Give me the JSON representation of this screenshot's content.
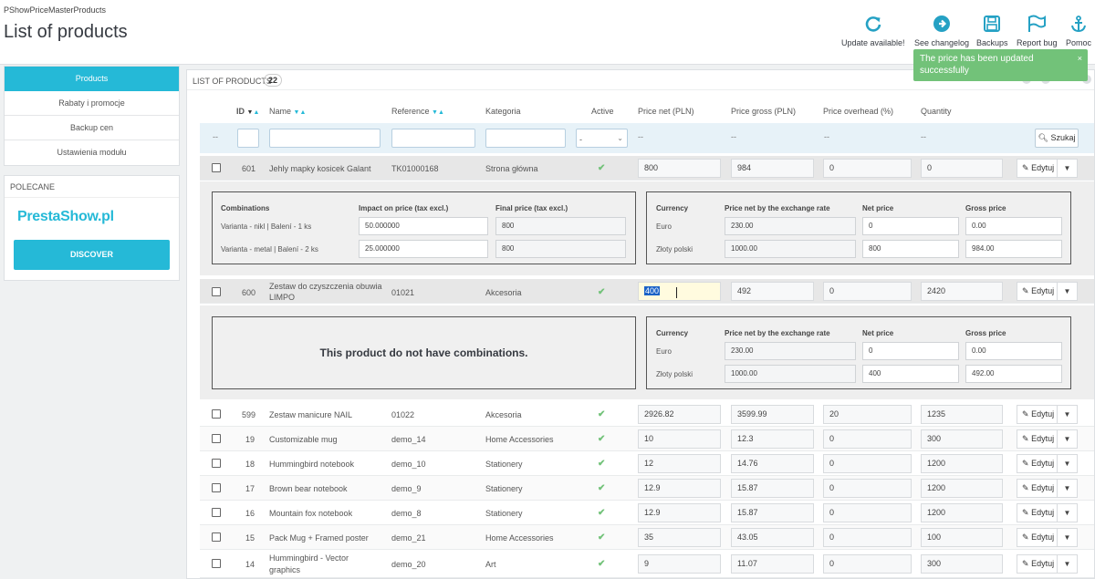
{
  "header": {
    "module_name": "PShowPriceMasterProducts",
    "page_title": "List of products",
    "toolbar": {
      "update": "Update available!",
      "changelog": "See changelog",
      "backups": "Backups",
      "report": "Report bug",
      "help": "Pomoc"
    }
  },
  "sidebar": {
    "items": [
      "Products",
      "Rabaty i promocje",
      "Backup cen",
      "Ustawienia modułu"
    ],
    "polecane": "POLECANE",
    "logo": "PrestaShow.pl",
    "discover": "DISCOVER"
  },
  "toast": {
    "message": "The price has been updated successfully",
    "close": "×"
  },
  "list": {
    "title": "LIST OF PRODUCTS",
    "count": "22",
    "headers": {
      "id": "ID",
      "name": "Name",
      "reference": "Reference",
      "category": "Kategoria",
      "active": "Active",
      "price_net": "Price net (PLN)",
      "price_gross": "Price gross (PLN)",
      "overhead": "Price overhead (%)",
      "quantity": "Quantity"
    },
    "filter": {
      "dash": "--",
      "select": "-",
      "search": "Szukaj"
    },
    "edit_label": "Edytuj",
    "products": [
      {
        "id": "601",
        "name": "Jehly mapky kosicek Galant",
        "ref": "TK01000168",
        "cat": "Strona główna",
        "net": "800",
        "gross": "984",
        "over": "0",
        "qty": "0"
      },
      {
        "id": "600",
        "name": "Zestaw do czyszczenia obuwia",
        "name2": "LIMPO",
        "ref": "01021",
        "cat": "Akcesoria",
        "net": "400",
        "gross": "492",
        "over": "0",
        "qty": "2420"
      },
      {
        "id": "599",
        "name": "Zestaw manicure NAIL",
        "ref": "01022",
        "cat": "Akcesoria",
        "net": "2926.82",
        "gross": "3599.99",
        "over": "20",
        "qty": "1235"
      },
      {
        "id": "19",
        "name": "Customizable mug",
        "ref": "demo_14",
        "cat": "Home Accessories",
        "net": "10",
        "gross": "12.3",
        "over": "0",
        "qty": "300"
      },
      {
        "id": "18",
        "name": "Hummingbird notebook",
        "ref": "demo_10",
        "cat": "Stationery",
        "net": "12",
        "gross": "14.76",
        "over": "0",
        "qty": "1200"
      },
      {
        "id": "17",
        "name": "Brown bear notebook",
        "ref": "demo_9",
        "cat": "Stationery",
        "net": "12.9",
        "gross": "15.87",
        "over": "0",
        "qty": "1200"
      },
      {
        "id": "16",
        "name": "Mountain fox notebook",
        "ref": "demo_8",
        "cat": "Stationery",
        "net": "12.9",
        "gross": "15.87",
        "over": "0",
        "qty": "1200"
      },
      {
        "id": "15",
        "name": "Pack Mug + Framed poster",
        "ref": "demo_21",
        "cat": "Home Accessories",
        "net": "35",
        "gross": "43.05",
        "over": "0",
        "qty": "100"
      },
      {
        "id": "14",
        "name": "Hummingbird - Vector",
        "name2": "graphics",
        "ref": "demo_20",
        "cat": "Art",
        "net": "9",
        "gross": "11.07",
        "over": "0",
        "qty": "300"
      }
    ],
    "combinations": {
      "headers": [
        "Combinations",
        "Impact on price (tax excl.)",
        "Final price (tax excl.)"
      ],
      "rows": [
        {
          "name": "Varianta - nikl | Balení - 1 ks",
          "impact": "50.000000",
          "final": "800"
        },
        {
          "name": "Varianta - metal | Balení - 2 ks",
          "impact": "25.000000",
          "final": "800"
        }
      ],
      "empty": "This product do not have combinations."
    },
    "currency": {
      "headers": [
        "Currency",
        "Price net by the exchange rate",
        "Net price",
        "Gross price"
      ],
      "p601": [
        {
          "cur": "Euro",
          "rate": "230.00",
          "net": "0",
          "gross": "0.00"
        },
        {
          "cur": "Złoty polski",
          "rate": "1000.00",
          "net": "800",
          "gross": "984.00"
        }
      ],
      "p600": [
        {
          "cur": "Euro",
          "rate": "230.00",
          "net": "0",
          "gross": "0.00"
        },
        {
          "cur": "Złoty polski",
          "rate": "1000.00",
          "net": "400",
          "gross": "492.00"
        }
      ]
    }
  }
}
